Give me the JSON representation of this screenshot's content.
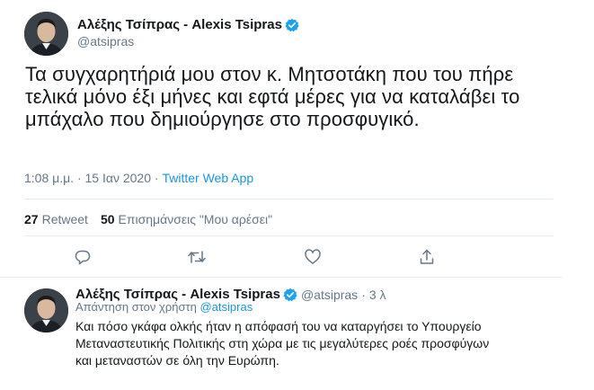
{
  "tweet": {
    "author_name": "Αλέξης Τσίπρας - Alexis Tsipras",
    "handle": "@atsipras",
    "text": "Τα συγχαρητήριά μου στον κ. Μητσοτάκη που του πήρε τελικά μόνο έξι μήνες και εφτά μέρες για να καταλάβει το μπάχαλο που δημιούργησε στο προσφυγικό.",
    "time": "1:08 μ.μ.",
    "separator": "·",
    "date": "15 Ιαν 2020",
    "app": "Twitter Web App",
    "retweet_count": "27",
    "retweet_label": "Retweet",
    "like_count": "50",
    "like_label": "Επισημάνσεις \"Μου αρέσει\""
  },
  "reply": {
    "author_name": "Αλέξης Τσίπρας - Alexis Tsipras",
    "handle": "@atsipras",
    "separator": "·",
    "age": "3 λ",
    "replying_to_label": "Απάντηση στον χρήστη",
    "replying_to_handle": "@atsipras",
    "text": "Και πόσο γκάφα ολκής ήταν η απόφασή του να καταργήσει το Υπουργείο Μεταναστευτικής Πολιτικής στη χώρα με τις μεγαλύτερες ροές προσφύγων και μεταναστών σε όλη την Ευρώπη."
  },
  "icons": {
    "verified": "verified-badge-icon",
    "reply": "reply-icon",
    "retweet": "retweet-icon",
    "like": "heart-icon",
    "share": "share-icon"
  },
  "colors": {
    "accent": "#1da1f2",
    "link": "#1b95e0",
    "secondary_text": "#657786",
    "primary_text": "#14171a",
    "divider": "#e6ecf0"
  }
}
